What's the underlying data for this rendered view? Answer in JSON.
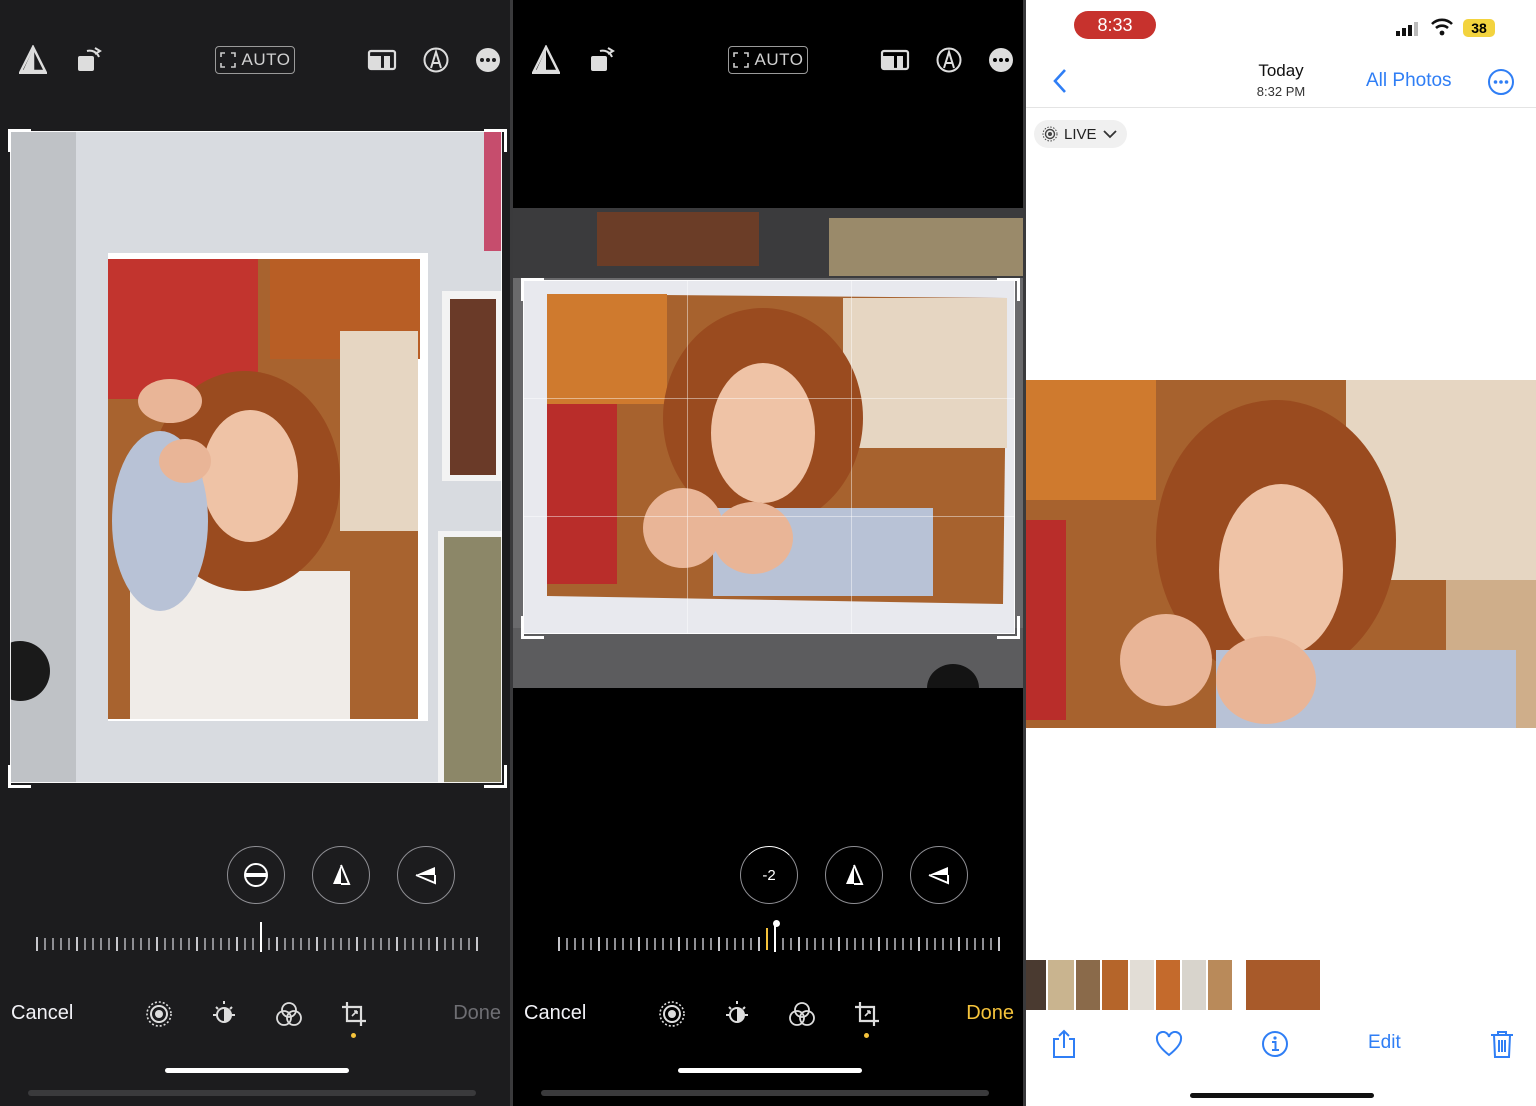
{
  "panel1": {
    "auto_label": "AUTO",
    "cancel_label": "Cancel",
    "done_label": "Done"
  },
  "panel2": {
    "auto_label": "AUTO",
    "straighten_value": "-2",
    "cancel_label": "Cancel",
    "done_label": "Done"
  },
  "panel3": {
    "status_time": "8:33",
    "battery_level": "38",
    "nav_title": "Today",
    "nav_subtitle": "8:32 PM",
    "all_photos_label": "All Photos",
    "live_label": "LIVE",
    "edit_label": "Edit"
  },
  "colors": {
    "accent_blue": "#2f7ef5",
    "done_yellow": "#f5c33b",
    "done_disabled": "#6e6e73",
    "status_red": "#c7322d",
    "battery_yellow": "#f3d33e"
  },
  "icons": [
    "perspective-icon",
    "rotate-icon",
    "aspect-ratio-icon",
    "markup-icon",
    "more-icon",
    "straighten-icon",
    "vertical-perspective-icon",
    "horizontal-perspective-icon",
    "live-photo-icon",
    "adjust-icon",
    "filters-icon",
    "crop-icon",
    "back-chevron-icon",
    "share-icon",
    "heart-icon",
    "info-icon",
    "trash-icon"
  ]
}
